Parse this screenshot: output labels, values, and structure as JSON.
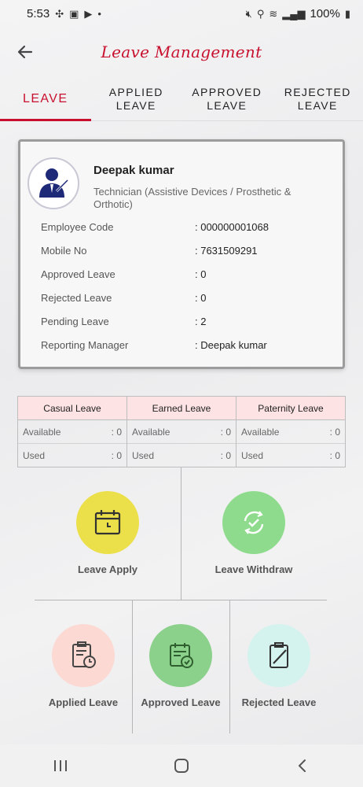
{
  "status_bar": {
    "time": "5:53",
    "battery": "100%"
  },
  "header": {
    "title": "Leave Management"
  },
  "tabs": [
    {
      "line1": "LEAVE",
      "line2": ""
    },
    {
      "line1": "APPLIED",
      "line2": "LEAVE"
    },
    {
      "line1": "APPROVED",
      "line2": "LEAVE"
    },
    {
      "line1": "REJECTED",
      "line2": "LEAVE"
    }
  ],
  "employee": {
    "name": "Deepak kumar",
    "role": "Technician (Assistive Devices / Prosthetic & Orthotic)",
    "details": [
      {
        "label": "Employee Code",
        "value": ": 000000001068"
      },
      {
        "label": "Mobile No",
        "value": ": 7631509291"
      },
      {
        "label": "Approved Leave",
        "value": ": 0"
      },
      {
        "label": "Rejected Leave",
        "value": ": 0"
      },
      {
        "label": "Pending Leave",
        "value": ": 2"
      },
      {
        "label": "Reporting Manager",
        "value": ": Deepak kumar"
      }
    ]
  },
  "balances": [
    {
      "title": "Casual Leave",
      "available_label": "Available",
      "available": ": 0",
      "used_label": "Used",
      "used": ": 0"
    },
    {
      "title": "Earned Leave",
      "available_label": "Available",
      "available": ": 0",
      "used_label": "Used",
      "used": ": 0"
    },
    {
      "title": "Paternity Leave",
      "available_label": "Available",
      "available": ": 0",
      "used_label": "Used",
      "used": ": 0"
    }
  ],
  "actions": {
    "leave_apply": "Leave Apply",
    "leave_withdraw": "Leave Withdraw",
    "applied_leave": "Applied Leave",
    "approved_leave": "Approved Leave",
    "rejected_leave": "Rejected Leave"
  },
  "colors": {
    "accent": "#c8102e",
    "apply_circle": "#ece04a",
    "withdraw_circle": "#8edb8e",
    "applied_circle": "#fcd9d3",
    "approved_circle": "#8bd08b",
    "rejected_circle": "#d4f3ee"
  }
}
